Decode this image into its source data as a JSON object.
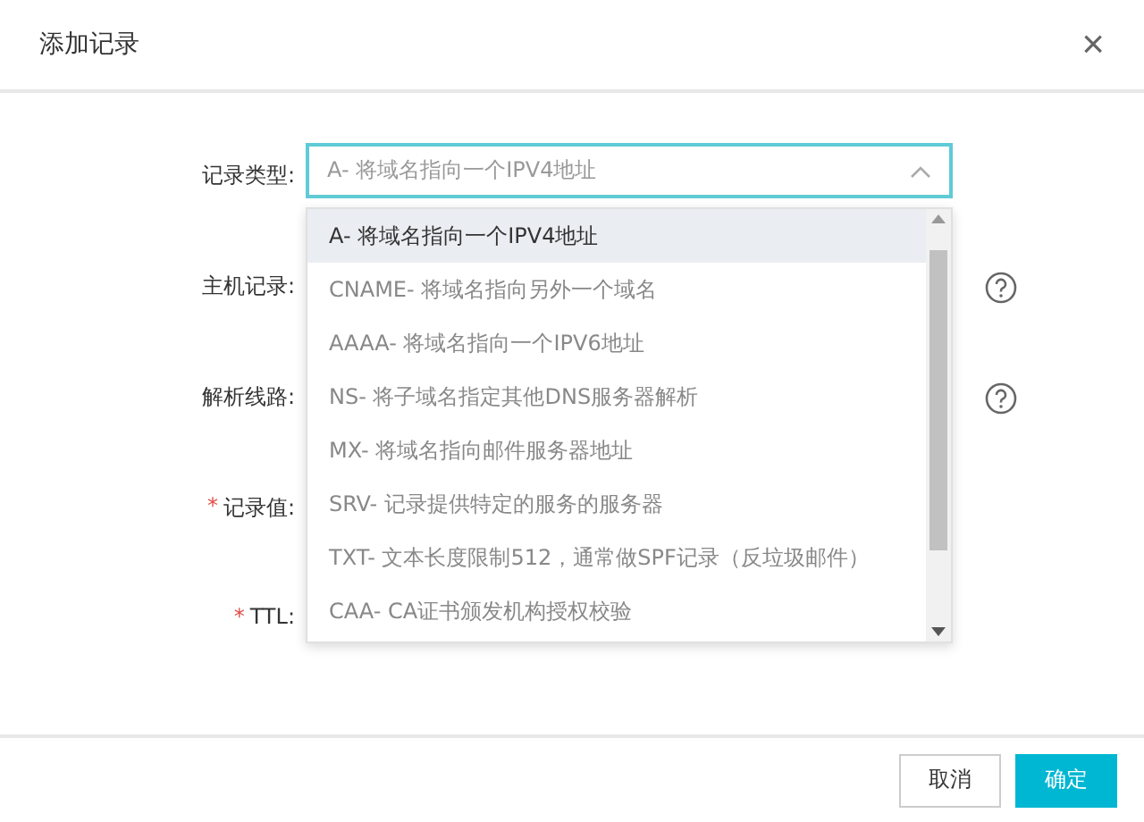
{
  "dialog": {
    "title": "添加记录",
    "close": "×"
  },
  "form": {
    "fields": [
      {
        "label": "记录类型:",
        "required": false,
        "help": false
      },
      {
        "label": "主机记录:",
        "required": false,
        "help": true
      },
      {
        "label": "解析线路:",
        "required": false,
        "help": true
      },
      {
        "label": "记录值:",
        "required": true,
        "help": false
      },
      {
        "label": "TTL:",
        "required": true,
        "help": false
      }
    ],
    "required_mark": "*"
  },
  "select": {
    "value": "A- 将域名指向一个IPV4地址",
    "expanded": true,
    "options": [
      {
        "label": "A- 将域名指向一个IPV4地址",
        "selected": true
      },
      {
        "label": "CNAME- 将域名指向另外一个域名",
        "selected": false
      },
      {
        "label": "AAAA- 将域名指向一个IPV6地址",
        "selected": false
      },
      {
        "label": "NS- 将子域名指定其他DNS服务器解析",
        "selected": false
      },
      {
        "label": "MX- 将域名指向邮件服务器地址",
        "selected": false
      },
      {
        "label": "SRV- 记录提供特定的服务的服务器",
        "selected": false
      },
      {
        "label": "TXT- 文本长度限制512，通常做SPF记录（反垃圾邮件）",
        "selected": false
      },
      {
        "label": "CAA- CA证书颁发机构授权校验",
        "selected": false
      }
    ]
  },
  "buttons": [
    {
      "label": "取消",
      "kind": "secondary"
    },
    {
      "label": "确定",
      "kind": "primary"
    }
  ]
}
